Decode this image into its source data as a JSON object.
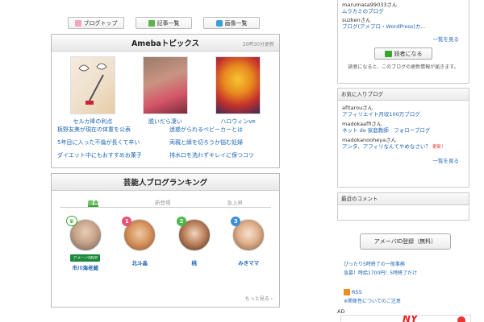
{
  "nav": {
    "blog_top": "ブログトップ",
    "entries": "記事一覧",
    "images": "画像一覧"
  },
  "topics": {
    "title": "Amebaトピックス",
    "updated": "20時30分更新",
    "thumbs": [
      {
        "caption": "セルカ棒の利点"
      },
      {
        "caption": "脱いだら凄い"
      },
      {
        "caption": "ハロウィンve"
      }
    ],
    "links": [
      "板野友美が現在の体重を公表",
      "迷惑がられるベビーカーとは",
      "5年目に入った不倫が長くて辛い",
      "両親と縁を切ろうか悩む妊婦",
      "ダイエット中にもおすすめお菓子",
      "排水口を洗わずキレイに保つコツ"
    ]
  },
  "ranking": {
    "title": "芸能人ブログランキング",
    "tabs": [
      "総合",
      "新登場",
      "急上昇"
    ],
    "rankers": [
      {
        "badge": "",
        "tag": "アメーバMVP",
        "name": "市川海老蔵"
      },
      {
        "badge": "1",
        "tag": "",
        "name": "北斗晶"
      },
      {
        "badge": "2",
        "tag": "",
        "name": "桃"
      },
      {
        "badge": "3",
        "tag": "",
        "name": "みきママ"
      }
    ],
    "more": "もっと見る ›"
  },
  "sidebar": {
    "readers": [
      {
        "name": "marumasa99033さん",
        "blog": "ムラカミのブログ",
        "update": ""
      },
      {
        "name": "suzkenさん",
        "blog": "ブログ(アメプロ・WordPress)カ…",
        "update": ""
      }
    ],
    "readers_more": "一覧を見る",
    "reader_button": "読者になる",
    "reader_note": "読者になると、このブログの更新情報が届きます。",
    "fav_title": "お気に入りブログ",
    "favorites": [
      {
        "name": "afitarouさん",
        "blog": "アフィリエイト月収100万ブログ",
        "update": ""
      },
      {
        "name": "madokaaffiさん",
        "blog": "ネット de 家庭教師　フォローブログ",
        "update": ""
      },
      {
        "name": "madokanooheyaさん",
        "blog": "アンタ、アフィリなんてやめなさい？",
        "update": "更新！"
      }
    ],
    "fav_more": "一覧を見る",
    "comments_title": "最近のコメント",
    "register": "アメーバID登録（無料）",
    "ad_lines": [
      "ぴったり5時終了の一般事務",
      "急募！時給1700円！5時終了だけ"
    ],
    "rss": "RSS",
    "rss_note": "※関係性についてのご注意",
    "ad_label": "AD",
    "ad_text": "NY"
  },
  "colors": {
    "link": "#1d64b4",
    "accent_green": "#37a62d",
    "badge_pink": "#e8507a",
    "badge_green": "#4cb848",
    "badge_blue": "#3a8fd8"
  }
}
